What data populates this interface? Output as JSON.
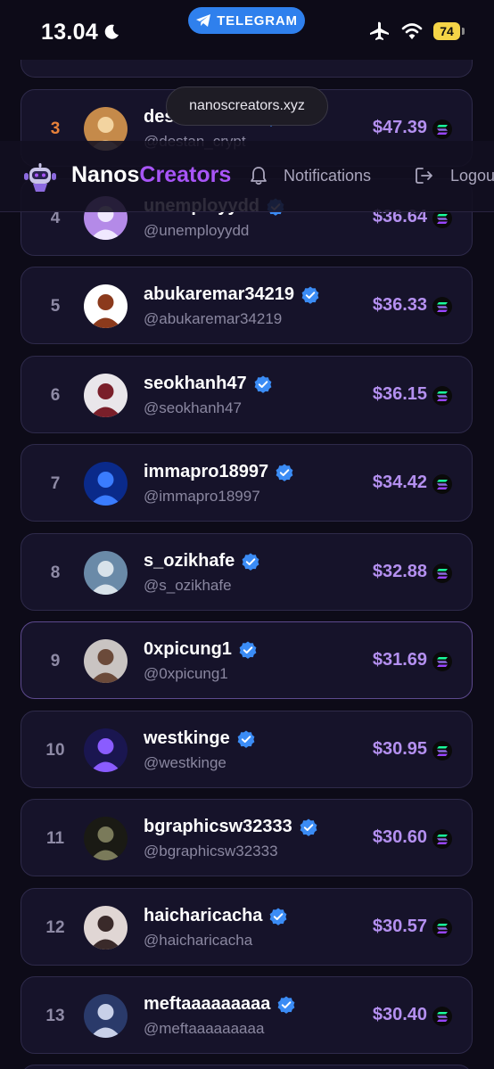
{
  "status_bar": {
    "time": "13.04",
    "telegram_label": "TELEGRAM",
    "battery": "74"
  },
  "browser": {
    "url": "nanoscreators.xyz"
  },
  "header": {
    "brand_part1": "Nanos",
    "brand_part2": "Creators",
    "notifications_label": "Notifications",
    "logout_label": "Logou"
  },
  "leaderboard": [
    {
      "rank": "3",
      "name": "destan_crypt",
      "handle": "@destan_crypt",
      "amount": "$47.39",
      "avatar_bg": "#c58a4a",
      "avatar_fg": "#f3d4a0"
    },
    {
      "rank": "4",
      "name": "unemployydd",
      "handle": "@unemployydd",
      "amount": "$36.64",
      "avatar_bg": "#b48ae8",
      "avatar_fg": "#f0e8ff"
    },
    {
      "rank": "5",
      "name": "abukaremar34219",
      "handle": "@abukaremar34219",
      "amount": "$36.33",
      "avatar_bg": "#ffffff",
      "avatar_fg": "#8b3a1c"
    },
    {
      "rank": "6",
      "name": "seokhanh47",
      "handle": "@seokhanh47",
      "amount": "$36.15",
      "avatar_bg": "#e9e6ea",
      "avatar_fg": "#7a1f2a"
    },
    {
      "rank": "7",
      "name": "immapro18997",
      "handle": "@immapro18997",
      "amount": "$34.42",
      "avatar_bg": "#0a2a8a",
      "avatar_fg": "#3a7cff"
    },
    {
      "rank": "8",
      "name": "s_ozikhafe",
      "handle": "@s_ozikhafe",
      "amount": "$32.88",
      "avatar_bg": "#6a8aa8",
      "avatar_fg": "#d8e2ea"
    },
    {
      "rank": "9",
      "name": "0xpicung1",
      "handle": "@0xpicung1",
      "amount": "$31.69",
      "avatar_bg": "#c9c4c2",
      "avatar_fg": "#6b4a3a"
    },
    {
      "rank": "10",
      "name": "westkinge",
      "handle": "@westkinge",
      "amount": "$30.95",
      "avatar_bg": "#1a1650",
      "avatar_fg": "#8a5cff"
    },
    {
      "rank": "11",
      "name": "bgraphicsw32333",
      "handle": "@bgraphicsw32333",
      "amount": "$30.60",
      "avatar_bg": "#1a1a14",
      "avatar_fg": "#7a7a5a"
    },
    {
      "rank": "12",
      "name": "haicharicacha",
      "handle": "@haicharicacha",
      "amount": "$30.57",
      "avatar_bg": "#e0d6d4",
      "avatar_fg": "#3a2a2a"
    },
    {
      "rank": "13",
      "name": "meftaaaaaaaaa",
      "handle": "@meftaaaaaaaaa",
      "amount": "$30.40",
      "avatar_bg": "#2a3a6a",
      "avatar_fg": "#c8d0e8"
    }
  ],
  "colors": {
    "accent": "#a855f7",
    "amount": "#b490f0",
    "gold_rank": "#e8813a",
    "verified": "#3b8cf5",
    "telegram": "#2f80ed"
  },
  "icons": {
    "moon": "moon-icon",
    "telegram": "telegram-plane-icon",
    "airplane": "airplane-mode-icon",
    "wifi": "wifi-icon",
    "bell": "bell-icon",
    "logout": "logout-icon",
    "verified": "verified-badge-icon",
    "solana": "solana-icon"
  }
}
